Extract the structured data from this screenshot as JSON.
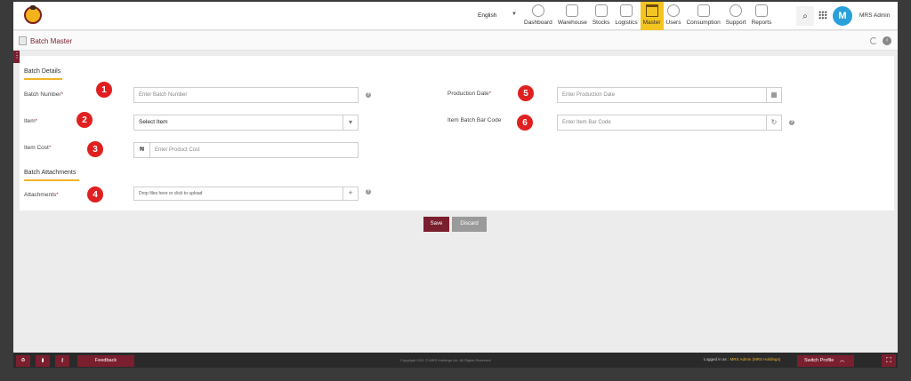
{
  "header": {
    "language": "English",
    "nav": [
      {
        "label": "Dashboard",
        "icon": "speedometer-icon"
      },
      {
        "label": "Warehouse",
        "icon": "warehouse-icon"
      },
      {
        "label": "Stocks",
        "icon": "stocks-icon"
      },
      {
        "label": "Logistics",
        "icon": "logistics-icon"
      },
      {
        "label": "Master",
        "icon": "crown-icon"
      },
      {
        "label": "Users",
        "icon": "users-icon"
      },
      {
        "label": "Consumption",
        "icon": "consumption-icon"
      },
      {
        "label": "Support",
        "icon": "support-icon"
      },
      {
        "label": "Reports",
        "icon": "reports-icon"
      }
    ],
    "active_nav": "Master",
    "avatar_initial": "M",
    "user_name": "MRS Admin"
  },
  "page": {
    "title": "Batch Master"
  },
  "form": {
    "batch_details": "Batch Details",
    "batch_number_label": "Batch Number",
    "batch_number_placeholder": "Enter Batch Number",
    "item_label": "Item",
    "item_value": "Select Item",
    "item_cost_label": "Item Cost",
    "currency_symbol": "₦",
    "item_cost_placeholder": "Enter Product Cost",
    "batch_attachments": "Batch Attachments",
    "attachments_label": "Attachments",
    "attachments_placeholder": "Drop files here or click to upload",
    "production_date_label": "Production Date",
    "production_date_placeholder": "Enter Production Date",
    "item_bar_code_label": "Item Batch Bar Code",
    "item_bar_code_placeholder": "Enter Item Bar Code",
    "required_mark": "*"
  },
  "badges": [
    "1",
    "2",
    "3",
    "4",
    "5",
    "6"
  ],
  "actions": {
    "save": "Save",
    "discard": "Discard"
  },
  "footer": {
    "feedback": "Feedback",
    "copyright": "Copyright 2021 © MRS Holdings Ltd. All Rights Reserved",
    "logged_in_as": "Logged in as :",
    "logged_user": "MRS Admin (MRS Holdings)",
    "switch_profile": "Switch Profile"
  },
  "colors": {
    "brand": "#7a1f2e",
    "accent": "#f4c520",
    "badge": "#e02020",
    "avatar": "#2aa0db"
  }
}
